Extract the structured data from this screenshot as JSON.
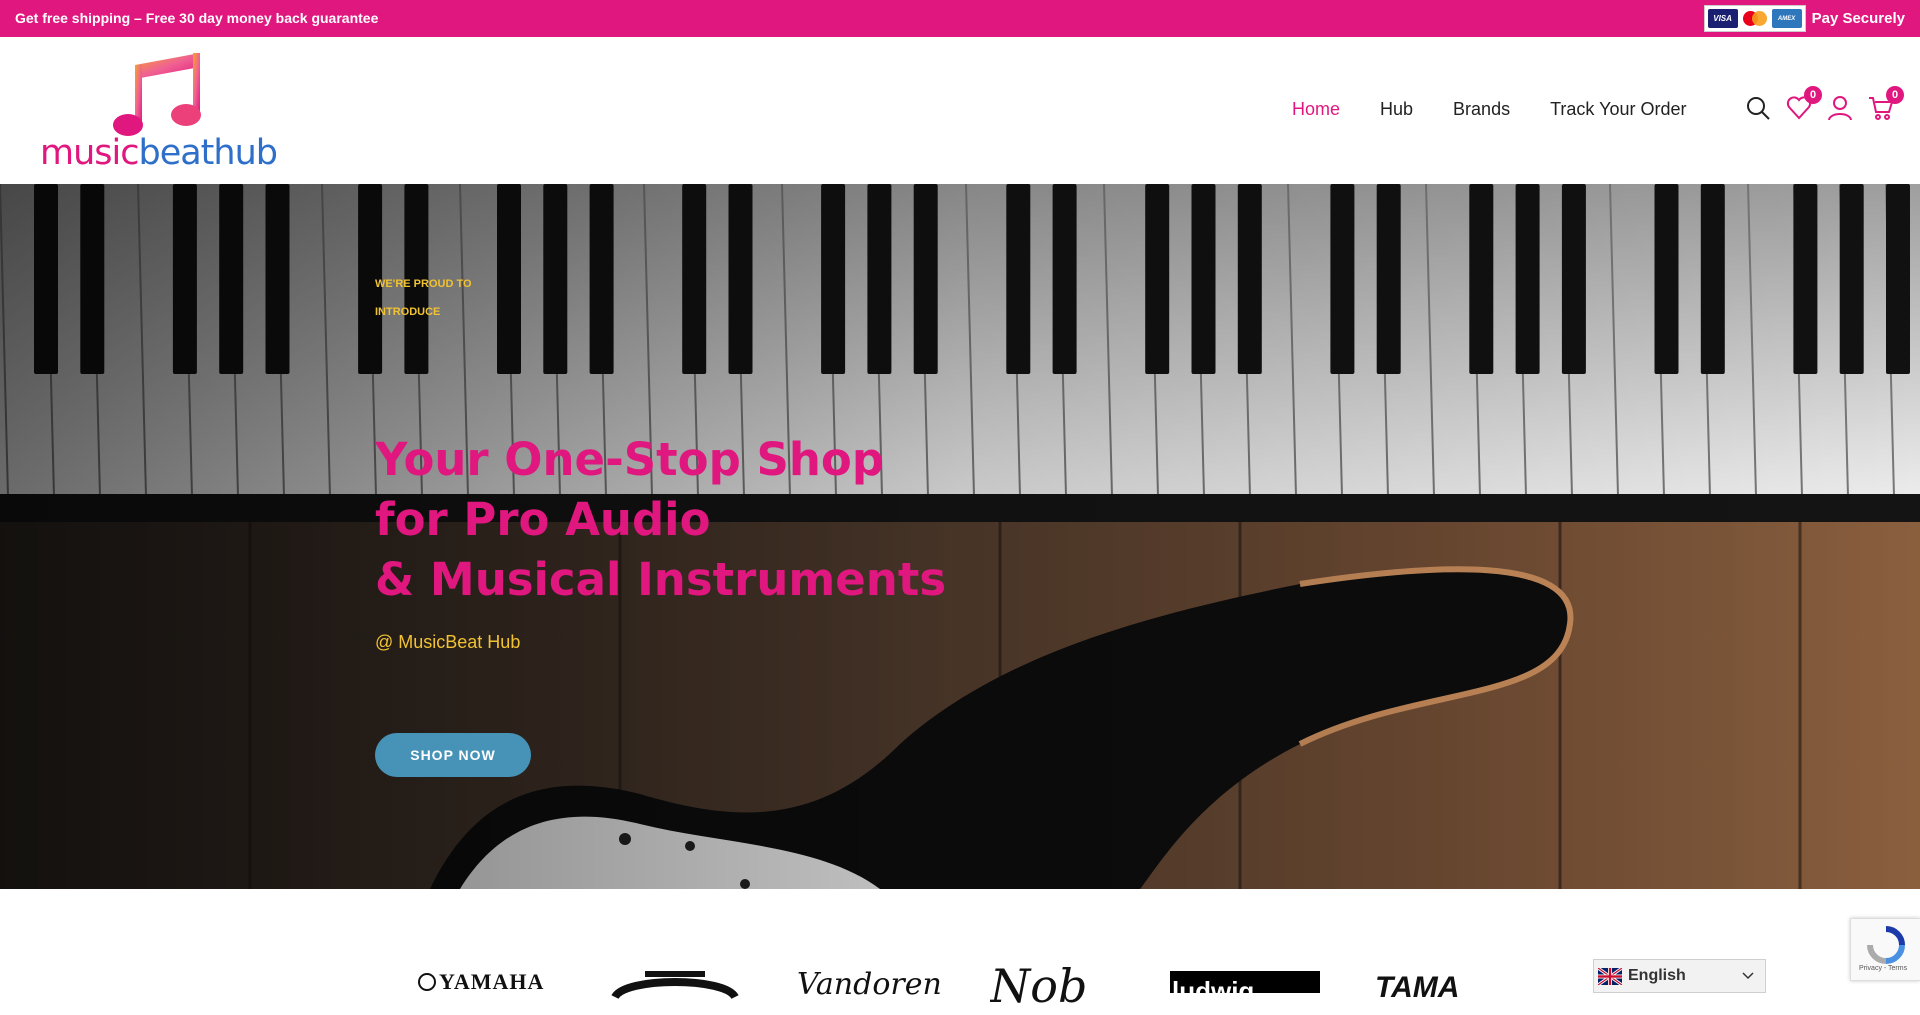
{
  "topbar": {
    "promo": "Get free shipping – Free 30 day money back guarantee",
    "cards": [
      "VISA",
      "MasterCard",
      "AMERICAN EXPRESS"
    ],
    "pay_label": "Pay Securely"
  },
  "logo": {
    "part1": "music",
    "part2": "beathub"
  },
  "nav": {
    "items": [
      {
        "label": "Home",
        "active": true
      },
      {
        "label": "Hub"
      },
      {
        "label": "Brands"
      },
      {
        "label": "Track Your Order"
      }
    ]
  },
  "header_icons": {
    "search": "search-icon",
    "wishlist_count": "0",
    "account": "user-icon",
    "cart_count": "0"
  },
  "hero": {
    "eyebrow": "WE'RE PROUD TO INTRODUCE",
    "headline_line1": "Your One-Stop Shop",
    "headline_line2": "for Pro Audio",
    "headline_line3": "& Musical Instruments",
    "subtitle": "@ MusicBeat Hub",
    "cta": "SHOP NOW"
  },
  "brands": {
    "yamaha": "YAMAHA",
    "vandoren": "Vandoren",
    "script": "Nob",
    "ludwig": "ludwig",
    "tama": "TAMA"
  },
  "language": {
    "selected": "English"
  },
  "recaptcha": {
    "links": "Privacy - Terms"
  },
  "colors": {
    "brand_pink": "#e0177f",
    "brand_blue": "#2e6fc9",
    "accent_yellow": "#f1c232",
    "cta_blue": "#4793b8"
  }
}
